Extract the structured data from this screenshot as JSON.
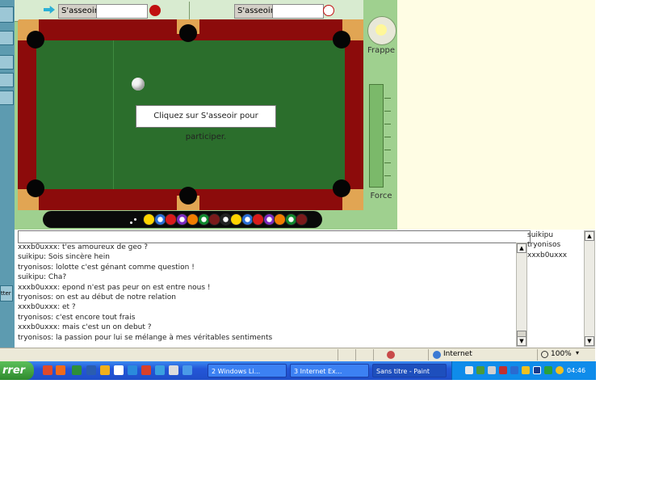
{
  "game": {
    "sit_button_left": "S'asseoir",
    "sit_button_right": "S'asseoir",
    "message": "Cliquez sur S'asseoir pour participer.",
    "strike_label": "Frappe",
    "force_label": "Force",
    "rack_ball_colors": [
      "#ffd400",
      "#2a6fd6",
      "#d81b1b",
      "#7b2cbf",
      "#f07d00",
      "#118a2e",
      "#7a1b1b",
      "#222222",
      "#ffd400",
      "#2a6fd6",
      "#d81b1b",
      "#7b2cbf",
      "#f07d00",
      "#118a2e",
      "#7a1b1b"
    ]
  },
  "chat": {
    "input_value": "",
    "messages": [
      "xxxb0uxxx: t'es amoureux de geo ?",
      "suikipu: Sois sincère hein",
      "tryonisos: lolotte c'est génant comme question !",
      "suikipu: Cha?",
      "xxxb0uxxx: epond n'est pas peur on est entre nous !",
      "tryonisos: on est au début de notre relation",
      "xxxb0uxxx: et ?",
      "tryonisos: c'est encore tout frais",
      "xxxb0uxxx: mais c'est un on debut ?",
      "tryonisos: la passion pour lui se mélange à mes véritables sentiments"
    ],
    "users": [
      "suikipu",
      "tryonisos",
      "xxxb0uxxx"
    ],
    "quit_label": "tter"
  },
  "statusbar": {
    "zone": "Internet",
    "zoom": "100%"
  },
  "taskbar": {
    "start_label": "rrer",
    "tasks": [
      "2 Windows Li...",
      "3 Internet Ex...",
      "Sans titre - Paint"
    ],
    "clock": "04:46"
  }
}
